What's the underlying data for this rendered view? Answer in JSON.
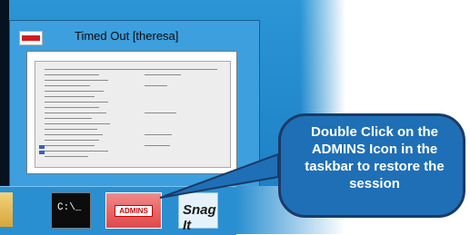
{
  "window_thumbnail": {
    "title": "Timed Out [theresa]",
    "icon": "admins-app-icon"
  },
  "taskbar": {
    "items": [
      {
        "name": "file-explorer",
        "icon": "folder-icon"
      },
      {
        "name": "command-prompt",
        "label": "C:\\_",
        "icon": "cmd-icon"
      },
      {
        "name": "admins",
        "label": "ADMINS",
        "icon": "admins-icon"
      },
      {
        "name": "snagit",
        "label": "Snag It",
        "icon": "snagit-icon"
      }
    ]
  },
  "callout": {
    "text": "Double Click on the ADMINS Icon in the taskbar to restore the session"
  },
  "colors": {
    "desktop_blue": "#2b95d6",
    "callout_fill": "#1f6fb6",
    "callout_border": "#1b3a66",
    "admins_red": "#e04848"
  }
}
